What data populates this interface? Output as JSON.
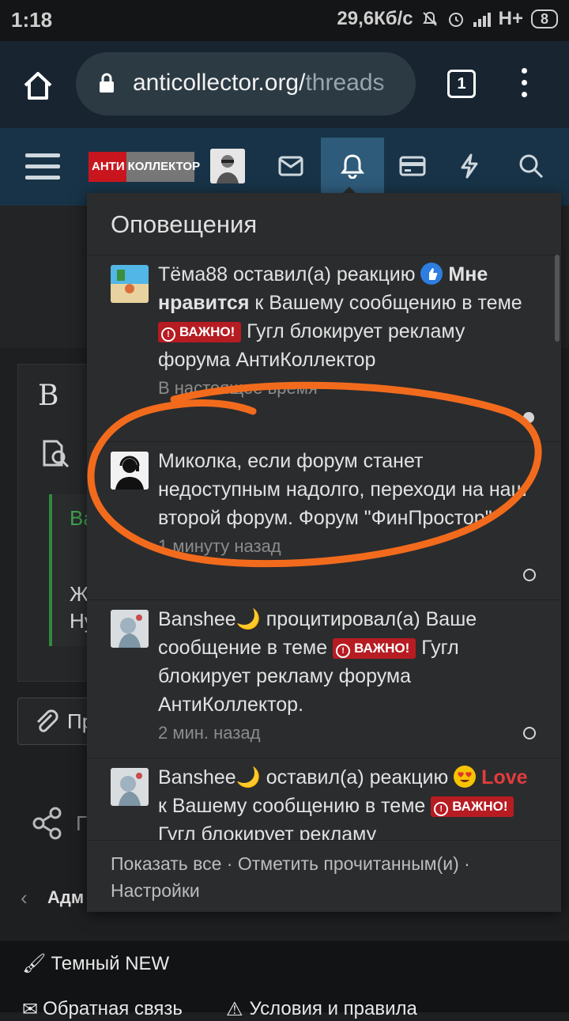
{
  "status_bar": {
    "time": "1:18",
    "network_speed": "29,6Кб/с",
    "network_type": "H+",
    "battery": "8"
  },
  "browser": {
    "url_main": "anticollector.org/",
    "url_path": "threads",
    "tab_count": "1"
  },
  "header": {
    "logo_part1": "АНТИ",
    "logo_part2": "КОЛЛЕКТОР",
    "icons": [
      "hamburger-icon",
      "envelope-icon",
      "bell-icon",
      "card-icon",
      "lightning-icon",
      "search-icon"
    ]
  },
  "background": {
    "big_letter": "B",
    "frag1": "Ва",
    "frag2": "Ж",
    "frag3": "Ну",
    "attach_frag": "Пр",
    "share_frag": "Г",
    "breadcrumb_frag": "Адм"
  },
  "footer_nav": {
    "theme": "Темный NEW",
    "feedback": "Обратная связь",
    "terms": "Условия и правила"
  },
  "notifications": {
    "title": "Оповещения",
    "items": [
      {
        "user": "Тёма88",
        "action": " оставил(а) реакцию ",
        "reaction": "Мне нравится",
        "mid": " к Вашему сообщению в теме ",
        "badge": "ВАЖНО!",
        "thread": " Гугл блокирует рекламу форума АнтиКоллектор",
        "time": "В настоящее время",
        "read": false
      },
      {
        "text": "Миколка, если форум станет недоступным надолго, переходи на наш второй форум. Форум \"ФинПростор\"",
        "time": "1 минуту назад",
        "read": true
      },
      {
        "user": "Banshee🌙",
        "action": " процитировал(а) Ваше сообщение в теме ",
        "badge": "ВАЖНО!",
        "thread": " Гугл блокирует рекламу форума АнтиКоллектор.",
        "time": "2 мин. назад",
        "read": true
      },
      {
        "user": "Banshee🌙",
        "action": " оставил(а) реакцию ",
        "reaction": "Love",
        "mid": " к Вашему сообщению в теме ",
        "badge": "ВАЖНО!",
        "thread": " Гугл блокирует рекламу",
        "read": true
      }
    ],
    "footer": {
      "show_all": "Показать все",
      "mark_read": "Отметить прочитанным(и)",
      "settings": "Настройки",
      "sep": " · "
    }
  },
  "colors": {
    "annotation": "#f26b1d",
    "badge": "#b61c22",
    "header": "#183347",
    "active_tab": "#2e5b7a"
  }
}
